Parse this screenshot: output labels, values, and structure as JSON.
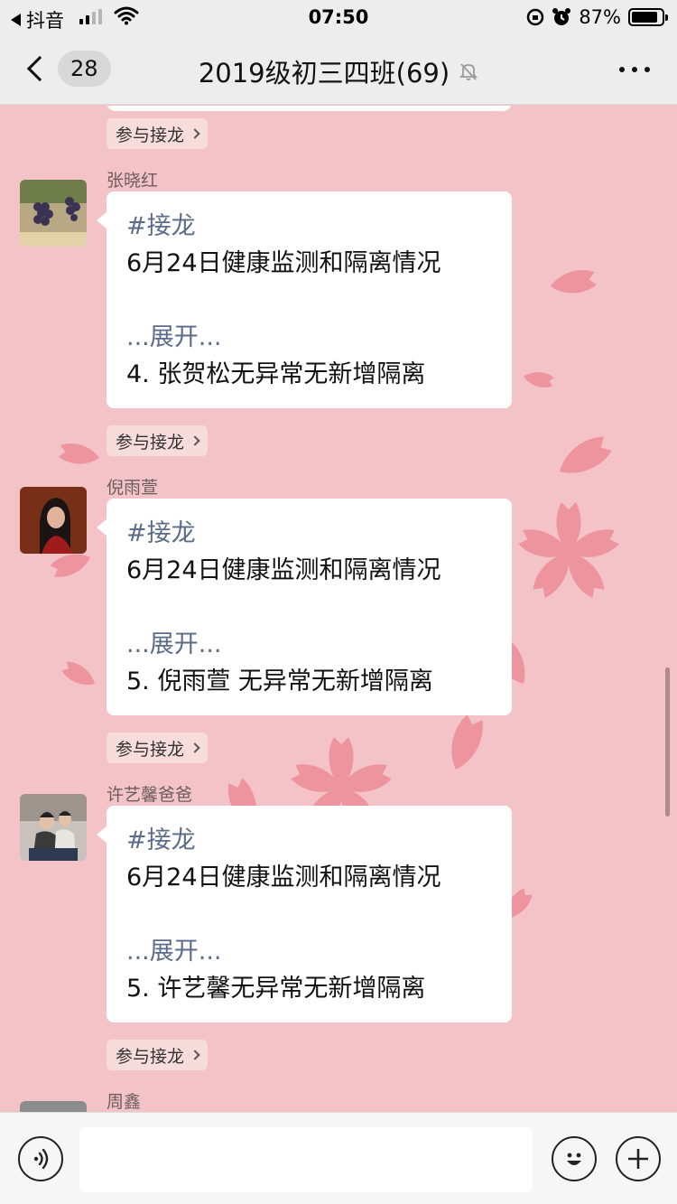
{
  "status_bar": {
    "back_app": "抖音",
    "time": "07:50",
    "battery_percent": "87%",
    "battery_level": 0.87
  },
  "nav": {
    "unread_count": "28",
    "title": "2019级初三四班(69)"
  },
  "chat": {
    "join_label": "参与接龙",
    "messages": [
      {
        "sender": "张晓红",
        "tag": "#接龙",
        "line1": "6月24日健康监测和隔离情况",
        "expand": "...展开...",
        "entry": "4. 张贺松无异常无新增隔离"
      },
      {
        "sender": "倪雨萱",
        "tag": "#接龙",
        "line1": "6月24日健康监测和隔离情况",
        "expand": "...展开...",
        "entry": "5. 倪雨萱 无异常无新增隔离"
      },
      {
        "sender": "许艺馨爸爸",
        "tag": "#接龙",
        "line1": "6月24日健康监测和隔离情况",
        "expand": "...展开...",
        "entry": "5. 许艺馨无异常无新增隔离"
      },
      {
        "sender": "周鑫"
      }
    ]
  },
  "colors": {
    "background": "#f4c3c8",
    "petal": "#ec8f99",
    "expand_link": "#5b6b8a"
  },
  "icons": {
    "voice": "voice-icon",
    "emoji": "emoji-icon",
    "more": "plus-icon"
  }
}
